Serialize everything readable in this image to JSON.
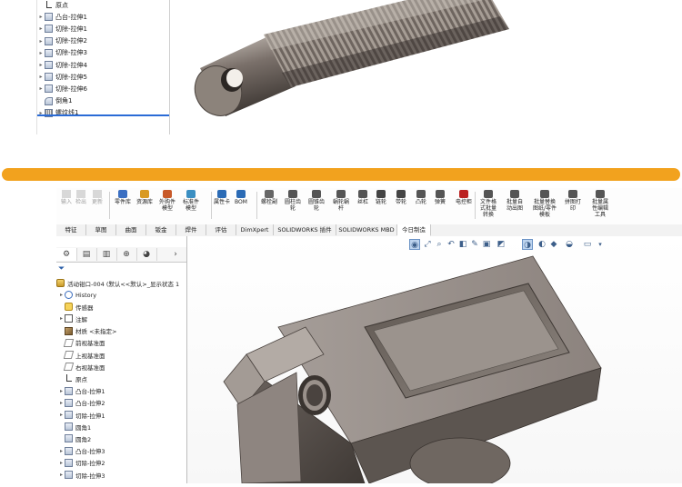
{
  "top_tree": {
    "items": [
      {
        "label": "原点",
        "icon": "origin-icon",
        "arrow": ""
      },
      {
        "label": "凸台-拉伸1",
        "icon": "extrude-boss-icon",
        "arrow": "▸"
      },
      {
        "label": "切除-拉伸1",
        "icon": "extrude-cut-icon",
        "arrow": "▸"
      },
      {
        "label": "切除-拉伸2",
        "icon": "extrude-cut-icon",
        "arrow": "▸"
      },
      {
        "label": "切除-拉伸3",
        "icon": "extrude-cut-icon",
        "arrow": "▸"
      },
      {
        "label": "切除-拉伸4",
        "icon": "extrude-cut-icon",
        "arrow": "▸"
      },
      {
        "label": "切除-拉伸5",
        "icon": "extrude-cut-icon",
        "arrow": "▸"
      },
      {
        "label": "切除-拉伸6",
        "icon": "extrude-cut-icon",
        "arrow": "▸"
      },
      {
        "label": "倒角1",
        "icon": "chamfer-icon",
        "arrow": ""
      },
      {
        "label": "螺纹线1",
        "icon": "thread-icon",
        "arrow": "▸"
      }
    ]
  },
  "ribbon": {
    "disabled": [
      {
        "label": "输入"
      },
      {
        "label": "检出"
      },
      {
        "label": "更新"
      }
    ],
    "groups": [
      {
        "label": "零件库"
      },
      {
        "label": "资源库"
      },
      {
        "label": "外购件\n模型"
      },
      {
        "label": "标准件\n模型"
      },
      {
        "label": "属性卡"
      },
      {
        "label": "BOM"
      },
      {
        "label": "螺栓副"
      },
      {
        "label": "圆柱齿\n轮"
      },
      {
        "label": "圆锥齿\n轮"
      },
      {
        "label": "蜗轮蜗\n杆"
      },
      {
        "label": "丝杠"
      },
      {
        "label": "链轮"
      },
      {
        "label": "带轮"
      },
      {
        "label": "凸轮"
      },
      {
        "label": "弹簧"
      },
      {
        "label": "电控柜"
      },
      {
        "label": "文件格\n式批量\n转换"
      },
      {
        "label": "批量自\n动出图"
      },
      {
        "label": "批量替换\n图纸/零件\n模板"
      },
      {
        "label": "拼图打\n印"
      },
      {
        "label": "批量属\n性编辑\n工具"
      }
    ]
  },
  "tabs": [
    "特征",
    "草图",
    "曲面",
    "钣金",
    "焊件",
    "评估",
    "DimXpert",
    "SOLIDWORKS 插件",
    "SOLIDWORKS MBD",
    "今日制造"
  ],
  "active_tab": "今日制造",
  "feature_tree": {
    "root": "活动钳口-004 (默认<<默认>_显示状态 1",
    "items": [
      {
        "label": "History",
        "icon": "history-icon",
        "arrow": "▸"
      },
      {
        "label": "传感器",
        "icon": "sensor-icon",
        "arrow": ""
      },
      {
        "label": "注解",
        "icon": "annotation-icon",
        "arrow": "▸"
      },
      {
        "label": "材质 <未指定>",
        "icon": "material-icon",
        "arrow": ""
      },
      {
        "label": "前视基准面",
        "icon": "plane-icon",
        "arrow": ""
      },
      {
        "label": "上视基准面",
        "icon": "plane-icon",
        "arrow": ""
      },
      {
        "label": "右视基准面",
        "icon": "plane-icon",
        "arrow": ""
      },
      {
        "label": "原点",
        "icon": "origin-icon",
        "arrow": ""
      },
      {
        "label": "凸台-拉伸1",
        "icon": "extrude-boss-icon",
        "arrow": "▸"
      },
      {
        "label": "凸台-拉伸2",
        "icon": "extrude-boss-icon",
        "arrow": "▸"
      },
      {
        "label": "切除-拉伸1",
        "icon": "extrude-cut-icon",
        "arrow": "▸"
      },
      {
        "label": "圆角1",
        "icon": "fillet-icon",
        "arrow": ""
      },
      {
        "label": "圆角2",
        "icon": "fillet-icon",
        "arrow": ""
      },
      {
        "label": "凸台-拉伸3",
        "icon": "extrude-boss-icon",
        "arrow": "▸"
      },
      {
        "label": "切除-拉伸2",
        "icon": "extrude-cut-icon",
        "arrow": "▸"
      },
      {
        "label": "切除-拉伸3",
        "icon": "extrude-cut-icon",
        "arrow": "▸"
      }
    ]
  },
  "colors": {
    "accent_bar": "#f2a21e",
    "selection": "#2a6bd6",
    "model_metal": "#8a8078"
  }
}
